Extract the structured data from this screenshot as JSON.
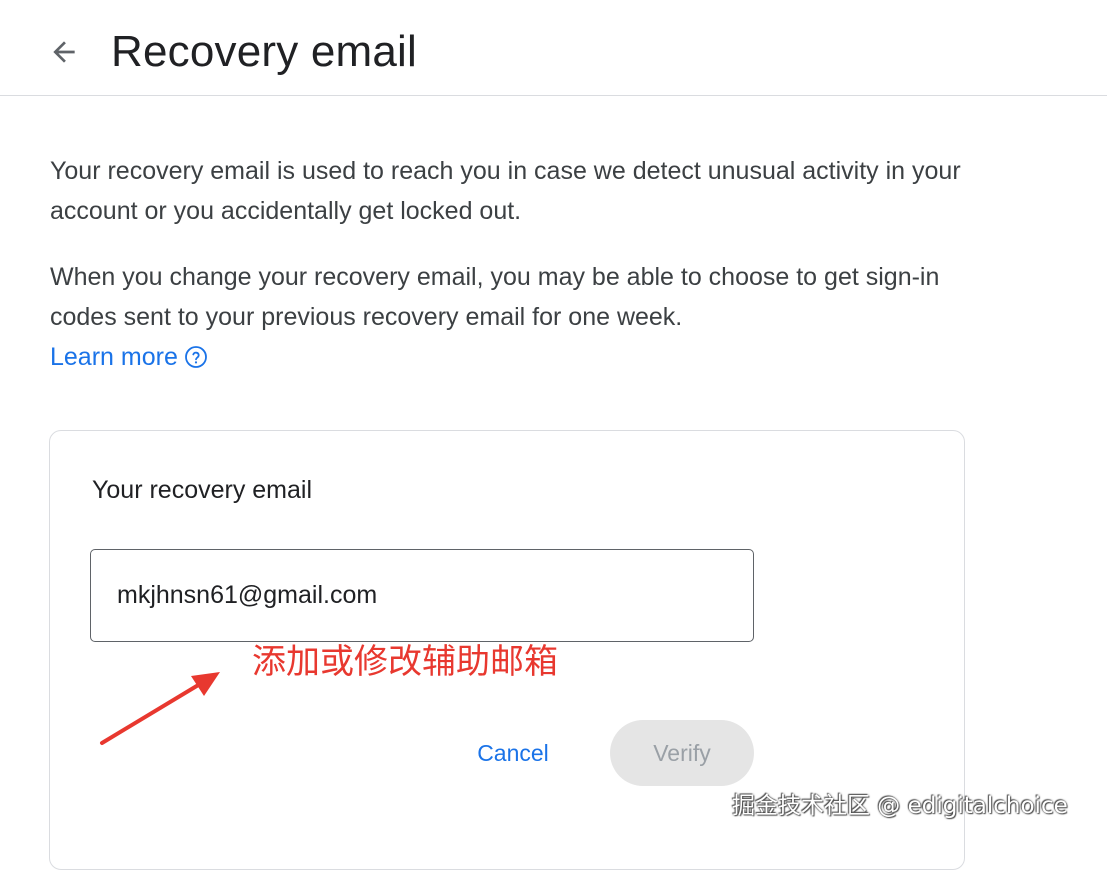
{
  "header": {
    "back_icon": "arrow-back-icon",
    "title": "Recovery email"
  },
  "intro": {
    "paragraph1": "Your recovery email is used to reach you in case we detect unusual activity in your account or you accidentally get locked out.",
    "paragraph2": "When you change your recovery email, you may be able to choose to get sign-in codes sent to your previous recovery email for one week.",
    "learn_more": "Learn more",
    "help_icon": "help-circle-icon"
  },
  "card": {
    "title": "Your recovery email",
    "email_value": "mkjhnsn61@gmail.com",
    "cancel_label": "Cancel",
    "verify_label": "Verify"
  },
  "annotation": {
    "text": "添加或修改辅助邮箱",
    "color": "#e8382f"
  },
  "watermark": {
    "text": "掘金技术社区 @ edigitalchoice"
  },
  "colors": {
    "link": "#1a73e8",
    "text": "#202124",
    "secondary_text": "#3c4043",
    "border": "#dadce0",
    "disabled_bg": "#e5e5e5",
    "disabled_text": "#9aa0a6"
  }
}
